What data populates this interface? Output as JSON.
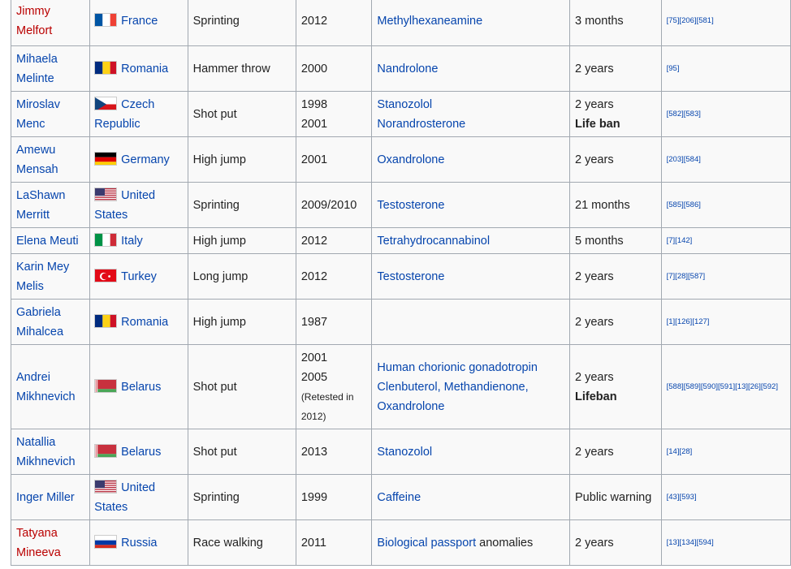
{
  "rows": [
    {
      "name": "Jimmy Melfort",
      "name_color": "red",
      "country": "France",
      "flag": "france",
      "event": "Sprinting",
      "years": [
        "2012"
      ],
      "substances": [
        {
          "text": "Methylhexaneamine",
          "link": true
        }
      ],
      "penalty": [
        {
          "text": "3 months",
          "bold": false
        }
      ],
      "refs": "[75][206][581]"
    },
    {
      "name": "Mihaela Melinte",
      "name_color": "blue",
      "country": "Romania",
      "flag": "romania",
      "event": "Hammer throw",
      "years": [
        "2000"
      ],
      "substances": [
        {
          "text": "Nandrolone",
          "link": true
        }
      ],
      "penalty": [
        {
          "text": "2 years",
          "bold": false
        }
      ],
      "refs": "[95]"
    },
    {
      "name": "Miroslav Menc",
      "name_color": "blue",
      "country": "Czech Republic",
      "flag": "czech",
      "event": "Shot put",
      "years": [
        "1998",
        "2001"
      ],
      "substances": [
        {
          "text": "Stanozolol",
          "link": true
        },
        {
          "text": "Norandrosterone",
          "link": true
        }
      ],
      "penalty": [
        {
          "text": "2 years",
          "bold": false
        },
        {
          "text": "Life ban",
          "bold": true
        }
      ],
      "refs": "[582][583]"
    },
    {
      "name": "Amewu Mensah",
      "name_color": "blue",
      "country": "Germany",
      "flag": "germany",
      "event": "High jump",
      "years": [
        "2001"
      ],
      "substances": [
        {
          "text": "Oxandrolone",
          "link": true
        }
      ],
      "penalty": [
        {
          "text": "2 years",
          "bold": false
        }
      ],
      "refs": "[203][584]"
    },
    {
      "name": "LaShawn Merritt",
      "name_color": "blue",
      "country": "United States",
      "flag": "usa",
      "event": "Sprinting",
      "years": [
        "2009/2010"
      ],
      "substances": [
        {
          "text": "Testosterone",
          "link": true
        }
      ],
      "penalty": [
        {
          "text": "21 months",
          "bold": false
        }
      ],
      "refs": "[585][586]"
    },
    {
      "name": "Elena Meuti",
      "name_color": "blue",
      "country": "Italy",
      "flag": "italy",
      "event": "High jump",
      "years": [
        "2012"
      ],
      "substances": [
        {
          "text": "Tetrahydrocannabinol",
          "link": true
        }
      ],
      "penalty": [
        {
          "text": "5 months",
          "bold": false
        }
      ],
      "refs": "[7][142]"
    },
    {
      "name": "Karin Mey Melis",
      "name_color": "blue",
      "country": "Turkey",
      "flag": "turkey",
      "event": "Long jump",
      "years": [
        "2012"
      ],
      "substances": [
        {
          "text": "Testosterone",
          "link": true
        }
      ],
      "penalty": [
        {
          "text": "2 years",
          "bold": false
        }
      ],
      "refs": "[7][28][587]"
    },
    {
      "name": "Gabriela Mihalcea",
      "name_color": "blue",
      "country": "Romania",
      "flag": "romania",
      "event": "High jump",
      "years": [
        "1987"
      ],
      "substances": [],
      "penalty": [
        {
          "text": "2 years",
          "bold": false
        }
      ],
      "refs": "[1][126][127]"
    },
    {
      "name": "Andrei Mikhnevich",
      "name_color": "blue",
      "country": "Belarus",
      "flag": "belarus",
      "event": "Shot put",
      "years": [
        "2001",
        "2005"
      ],
      "years_note": "(Retested in 2012)",
      "substances": [
        {
          "text": "Human chorionic gonadotropin",
          "link": true
        },
        {
          "text": "Clenbuterol, Methandienone,",
          "link": true
        },
        {
          "text": "Oxandrolone",
          "link": true
        }
      ],
      "penalty": [
        {
          "text": "2 years",
          "bold": false
        },
        {
          "text": "Lifeban",
          "bold": true
        }
      ],
      "refs": "[588][589][590][591][13][26][592]"
    },
    {
      "name": "Natallia Mikhnevich",
      "name_color": "blue",
      "country": "Belarus",
      "flag": "belarus",
      "event": "Shot put",
      "years": [
        "2013"
      ],
      "substances": [
        {
          "text": "Stanozolol",
          "link": true
        }
      ],
      "penalty": [
        {
          "text": "2 years",
          "bold": false
        }
      ],
      "refs": "[14][28]"
    },
    {
      "name": "Inger Miller",
      "name_color": "blue",
      "country": "United States",
      "flag": "usa",
      "event": "Sprinting",
      "years": [
        "1999"
      ],
      "substances": [
        {
          "text": "Caffeine",
          "link": true
        }
      ],
      "penalty": [
        {
          "text": "Public warning",
          "bold": false
        }
      ],
      "refs": "[43][593]"
    },
    {
      "name": "Tatyana Mineeva",
      "name_color": "red",
      "country": "Russia",
      "flag": "russia",
      "event": "Race walking",
      "years": [
        "2011"
      ],
      "substances": [
        {
          "text": "Biological passport",
          "link": true
        },
        {
          "text": " anomalies",
          "link": false,
          "inline": true
        }
      ],
      "penalty": [
        {
          "text": "2 years",
          "bold": false
        }
      ],
      "refs": "[13][134][594]"
    }
  ]
}
